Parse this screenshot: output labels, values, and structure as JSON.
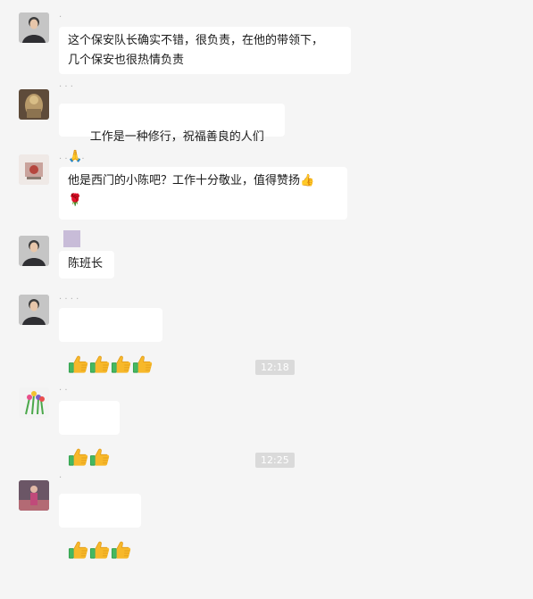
{
  "messages": [
    {
      "nick": "·",
      "text": "这个保安队长确实不错，很负责，在他的带领下，\n几个保安也很热情负责"
    },
    {
      "nick": "· · ·",
      "text": "工作是一种修行，祝福善良的人们🙏"
    },
    {
      "nick": "· · · · ·",
      "text": "他是西门的小陈吧？工作十分敬业，值得赞扬👍\n🌹"
    },
    {
      "nick": "",
      "text": "陈班长"
    },
    {
      "nick": "· · · ·",
      "emoji": [
        "thumbs-up",
        "thumbs-up",
        "thumbs-up",
        "thumbs-up"
      ]
    },
    {
      "nick": "· ·",
      "emoji": [
        "thumbs-up",
        "thumbs-up"
      ]
    },
    {
      "nick": "·",
      "emoji": [
        "thumbs-up",
        "thumbs-up",
        "thumbs-up"
      ]
    }
  ],
  "timestamps": [
    "12:18",
    "12:25"
  ],
  "colors": {
    "background": "#f5f5f5",
    "bubble": "#ffffff",
    "time_badge": "#dadada"
  }
}
